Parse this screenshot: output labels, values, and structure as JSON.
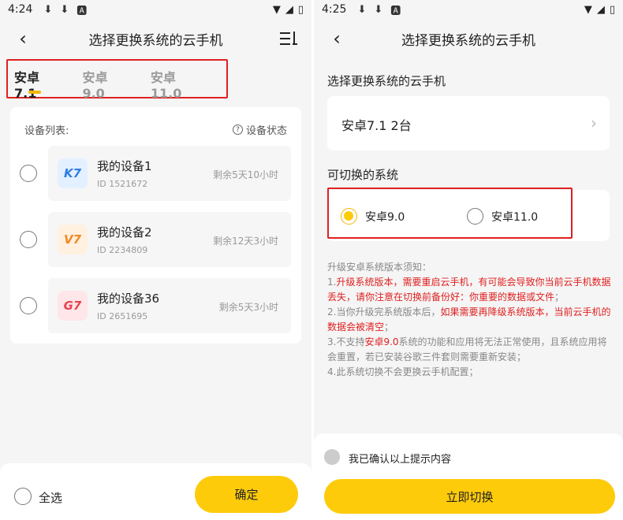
{
  "left": {
    "status": {
      "time": "4:24"
    },
    "title": "选择更换系统的云手机",
    "tabs": [
      {
        "label": "安卓7.1",
        "active": true
      },
      {
        "label": "安卓9.0",
        "active": false
      },
      {
        "label": "安卓11.0",
        "active": false
      }
    ],
    "device_list_label": "设备列表:",
    "device_status_label": "设备状态",
    "devices": [
      {
        "logo": "K7",
        "name": "我的设备1",
        "id": "ID 1521672",
        "remain": "剩余5天10小时"
      },
      {
        "logo": "V7",
        "name": "我的设备2",
        "id": "ID 2234809",
        "remain": "剩余12天3小时"
      },
      {
        "logo": "G7",
        "name": "我的设备36",
        "id": "ID 2651695",
        "remain": "剩余5天3小时"
      }
    ],
    "select_all_label": "全选",
    "confirm_label": "确定"
  },
  "right": {
    "status": {
      "time": "4:25"
    },
    "title": "选择更换系统的云手机",
    "current_section_label": "选择更换系统的云手机",
    "current_device": "安卓7.1 2台",
    "switchable_label": "可切换的系统",
    "options": [
      {
        "label": "安卓9.0",
        "checked": true
      },
      {
        "label": "安卓11.0",
        "checked": false
      }
    ],
    "notice": {
      "heading": "升级安卓系统版本须知：",
      "item1_prefix": "1.",
      "item1_red": "升级系统版本，需要重启云手机，有可能会导致你当前云手机数据丢失，请你注意在切换前备份好：你重要的数据或文件",
      "item1_suffix": "；",
      "item2_prefix": "2.当你升级完系统版本后，",
      "item2_red": "如果需要再降级系统版本，当前云手机的数据会被清空",
      "item2_suffix": "；",
      "item3_prefix": "3.不支持",
      "item3_red": "安卓9.0",
      "item3_suffix": "系统的功能和应用将无法正常使用，且系统应用将会重置，若已安装谷歌三件套则需要重新安装；",
      "item4": "4.此系统切换不会更换云手机配置；"
    },
    "ack_label": "我已确认以上提示内容",
    "switch_label": "立即切换"
  },
  "colors": {
    "accent": "#fecb0b",
    "highlight_border": "#e02020",
    "indicator": "#f6b400"
  },
  "logo_colors": {
    "K7": {
      "bg": "#e3f0ff",
      "fg": "#2f7de1"
    },
    "V7": {
      "bg": "#fff0e0",
      "fg": "#f08a24"
    },
    "G7": {
      "bg": "#ffe6e8",
      "fg": "#e8434f"
    }
  }
}
